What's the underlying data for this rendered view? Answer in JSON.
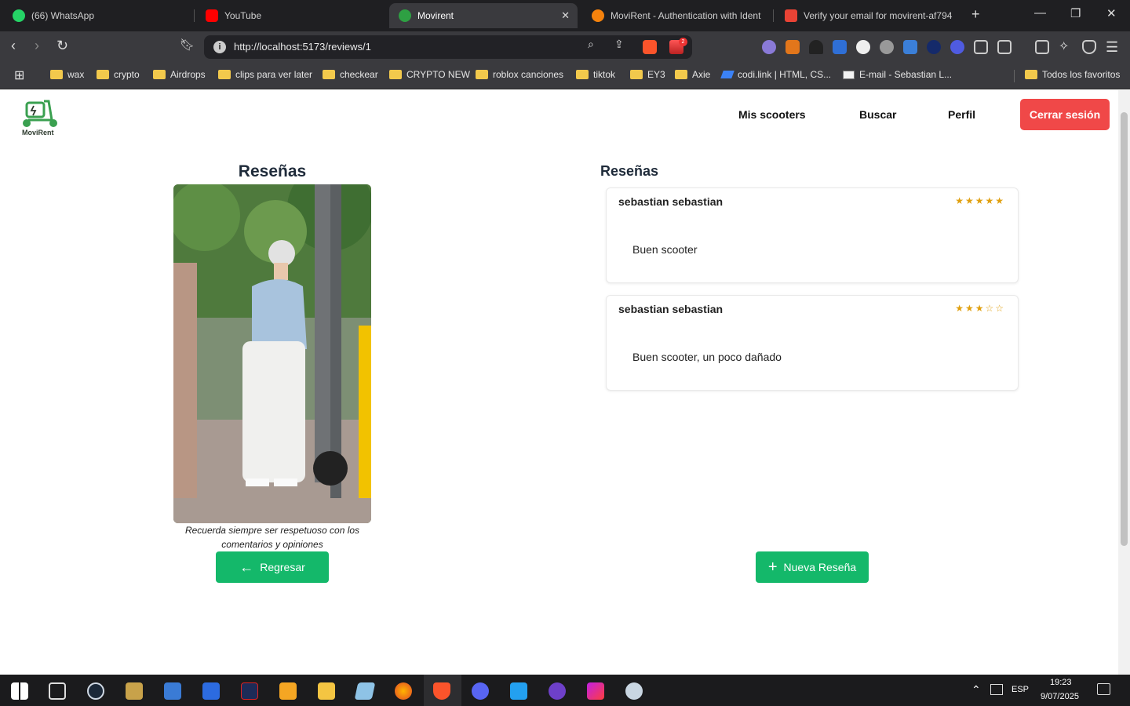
{
  "tabs": [
    {
      "title": "(66) WhatsApp",
      "icon": "whatsapp-icon",
      "color": "#25d366"
    },
    {
      "title": "YouTube",
      "icon": "youtube-icon",
      "color": "#ff0000"
    },
    {
      "title": "Movirent",
      "icon": "movirent-icon",
      "color": "#2ea043"
    },
    {
      "title": "MoviRent - Authentication with Ident",
      "icon": "firebase-icon",
      "color": "#f5820d"
    },
    {
      "title": "Verify your email for movirent-af794",
      "icon": "gmail-icon",
      "color": "#ea4335"
    }
  ],
  "browser": {
    "url": "http://localhost:5173/reviews/1",
    "brave_badge": "2"
  },
  "bookmarks": [
    {
      "label": "wax"
    },
    {
      "label": "crypto"
    },
    {
      "label": "Airdrops"
    },
    {
      "label": "clips para ver later"
    },
    {
      "label": "checkear"
    },
    {
      "label": "CRYPTO NEW"
    },
    {
      "label": "roblox canciones"
    },
    {
      "label": "tiktok"
    },
    {
      "label": "EY3"
    },
    {
      "label": "Axie"
    },
    {
      "label": "codi.link | HTML, CS..."
    },
    {
      "label": "E-mail - Sebastian L..."
    }
  ],
  "bookmarks_all": "Todos los favoritos",
  "app": {
    "logo_text": "MoviRent",
    "nav": {
      "scooters": "Mis scooters",
      "search": "Buscar",
      "profile": "Perfil",
      "logout": "Cerrar sesión"
    },
    "left_title": "Reseñas",
    "caption": "Recuerda siempre ser respetuoso con los comentarios y opiniones",
    "back_label": "Regresar",
    "right_title": "Reseñas",
    "new_review_label": "Nueva Reseña",
    "reviews": [
      {
        "user": "sebastian sebastian",
        "stars": "★★★★★",
        "rating": 5,
        "comment": "Buen scooter"
      },
      {
        "user": "sebastian sebastian",
        "stars": "★★★☆☆",
        "rating": 3,
        "comment": "Buen scooter, un poco dañado"
      }
    ],
    "colors": {
      "primary": "#14b86a",
      "danger": "#f04848",
      "star": "#e0a010"
    }
  },
  "taskbar": {
    "lang": "ESP",
    "time": "19:23",
    "date": "9/07/2025"
  }
}
